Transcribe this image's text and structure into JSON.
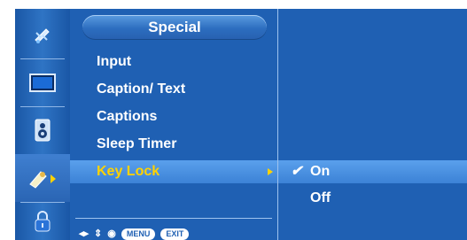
{
  "menu": {
    "title": "Special",
    "items": [
      {
        "label": "Input"
      },
      {
        "label": "Caption/ Text"
      },
      {
        "label": "Captions"
      },
      {
        "label": "Sleep Timer"
      },
      {
        "label": "Key Lock",
        "selected": true
      }
    ]
  },
  "submenu": {
    "options": [
      {
        "check": "✔",
        "label": "On",
        "selected": true
      },
      {
        "check": "",
        "label": "Off",
        "selected": false
      }
    ]
  },
  "footer": {
    "nav_lr": "◂▸",
    "nav_ud": "⇕",
    "enter": "◉",
    "menu_label": "MENU",
    "exit_label": "EXIT"
  },
  "sidebar": {
    "icons": [
      "satellite-dish-icon",
      "picture-icon",
      "sound-speaker-icon",
      "special-key-icon",
      "lock-icon"
    ],
    "active": "special-key-icon"
  },
  "colors": {
    "panel": "#1f60b3",
    "highlight_text": "#ffd200",
    "selection_bar": "#4a92e2"
  }
}
